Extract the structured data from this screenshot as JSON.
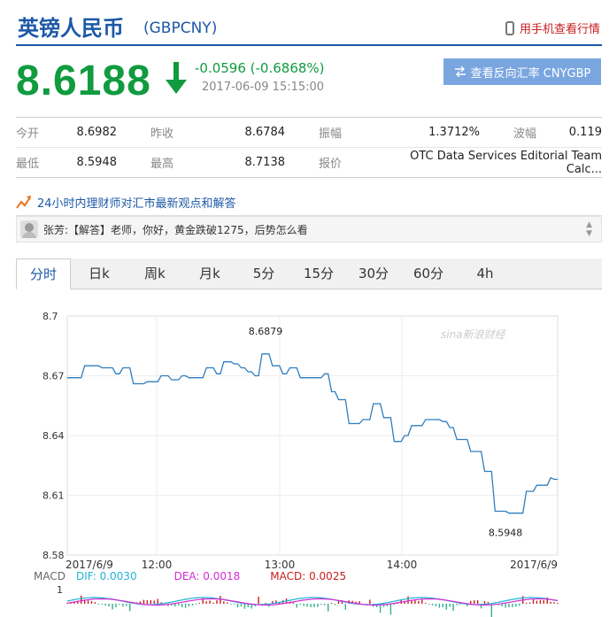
{
  "header": {
    "title": "英镑人民币",
    "code": "(GBPCNY)",
    "mobile_link": "用手机查看行情"
  },
  "quote": {
    "price": "8.6188",
    "change": "-0.0596 (-0.6868%)",
    "time": "2017-06-09 15:15:00",
    "reverse_button": "查看反向汇率 CNYGBP",
    "colors": {
      "down": "#109b3f",
      "brand": "#1c58a6"
    }
  },
  "stats": {
    "row1": [
      {
        "label": "今开",
        "value": "8.6982"
      },
      {
        "label": "昨收",
        "value": "8.6784"
      },
      {
        "label": "振幅",
        "value": "1.3712%"
      },
      {
        "label": "波幅",
        "value": "0.119"
      }
    ],
    "row2": [
      {
        "label": "最低",
        "value": "8.5948"
      },
      {
        "label": "最高",
        "value": "8.7138"
      },
      {
        "label": "报价",
        "value": "OTC Data Services Editorial Team Calc..."
      }
    ]
  },
  "advice": {
    "text": "24小时内理财师对汇市最新观点和解答",
    "icon": "trend-icon"
  },
  "qa": {
    "text": "张芳:【解答】老师，你好，黄金跌破1275，后势怎么看"
  },
  "tabs": [
    "分时",
    "日k",
    "周k",
    "月k",
    "5分",
    "15分",
    "30分",
    "60分",
    "4h"
  ],
  "active_tab": 0,
  "macd": {
    "label": "MACD",
    "dif": "DIF: 0.0030",
    "dea": "DEA: 0.0018",
    "macd": "MACD: 0.0025",
    "axis_value": "1",
    "colors": {
      "dif": "#1fb5d6",
      "dea": "#d42bd4",
      "macd": "#c81e1e"
    }
  },
  "chart_data": {
    "type": "line",
    "watermark": "sina新浪财经",
    "ylim": [
      8.58,
      8.7
    ],
    "y_ticks": [
      "8.7",
      "8.67",
      "8.64",
      "8.61",
      "8.58"
    ],
    "x_ticks": [
      "2017/6/9",
      "12:00",
      "13:00",
      "14:00",
      "2017/6/9"
    ],
    "annotations": [
      {
        "label": "8.6879",
        "x": 57,
        "y": 8.6879
      },
      {
        "label": "8.5948",
        "x": 126,
        "y": 8.5948
      }
    ],
    "series": [
      {
        "values": [
          8.669,
          8.669,
          8.669,
          8.669,
          8.669,
          8.675,
          8.675,
          8.675,
          8.675,
          8.675,
          8.674,
          8.674,
          8.674,
          8.674,
          8.671,
          8.671,
          8.674,
          8.674,
          8.674,
          8.666,
          8.666,
          8.666,
          8.666,
          8.667,
          8.667,
          8.667,
          8.667,
          8.67,
          8.67,
          8.67,
          8.668,
          8.668,
          8.668,
          8.67,
          8.67,
          8.669,
          8.669,
          8.669,
          8.669,
          8.669,
          8.674,
          8.674,
          8.674,
          8.671,
          8.671,
          8.677,
          8.677,
          8.677,
          8.676,
          8.676,
          8.674,
          8.674,
          8.672,
          8.672,
          8.67,
          8.67,
          8.681,
          8.681,
          8.681,
          8.675,
          8.675,
          8.675,
          8.671,
          8.671,
          8.674,
          8.674,
          8.674,
          8.669,
          8.669,
          8.669,
          8.669,
          8.669,
          8.669,
          8.669,
          8.671,
          8.671,
          8.662,
          8.662,
          8.658,
          8.658,
          8.658,
          8.646,
          8.646,
          8.646,
          8.646,
          8.648,
          8.648,
          8.648,
          8.656,
          8.656,
          8.656,
          8.649,
          8.649,
          8.649,
          8.637,
          8.637,
          8.637,
          8.64,
          8.64,
          8.645,
          8.645,
          8.645,
          8.645,
          8.648,
          8.648,
          8.648,
          8.648,
          8.648,
          8.647,
          8.647,
          8.644,
          8.644,
          8.638,
          8.638,
          8.638,
          8.638,
          8.632,
          8.632,
          8.632,
          8.632,
          8.622,
          8.622,
          8.622,
          8.602,
          8.602,
          8.602,
          8.602,
          8.601,
          8.601,
          8.601,
          8.601,
          8.601,
          8.612,
          8.612,
          8.612,
          8.615,
          8.615,
          8.615,
          8.615,
          8.6188,
          8.618,
          8.618
        ]
      }
    ]
  }
}
